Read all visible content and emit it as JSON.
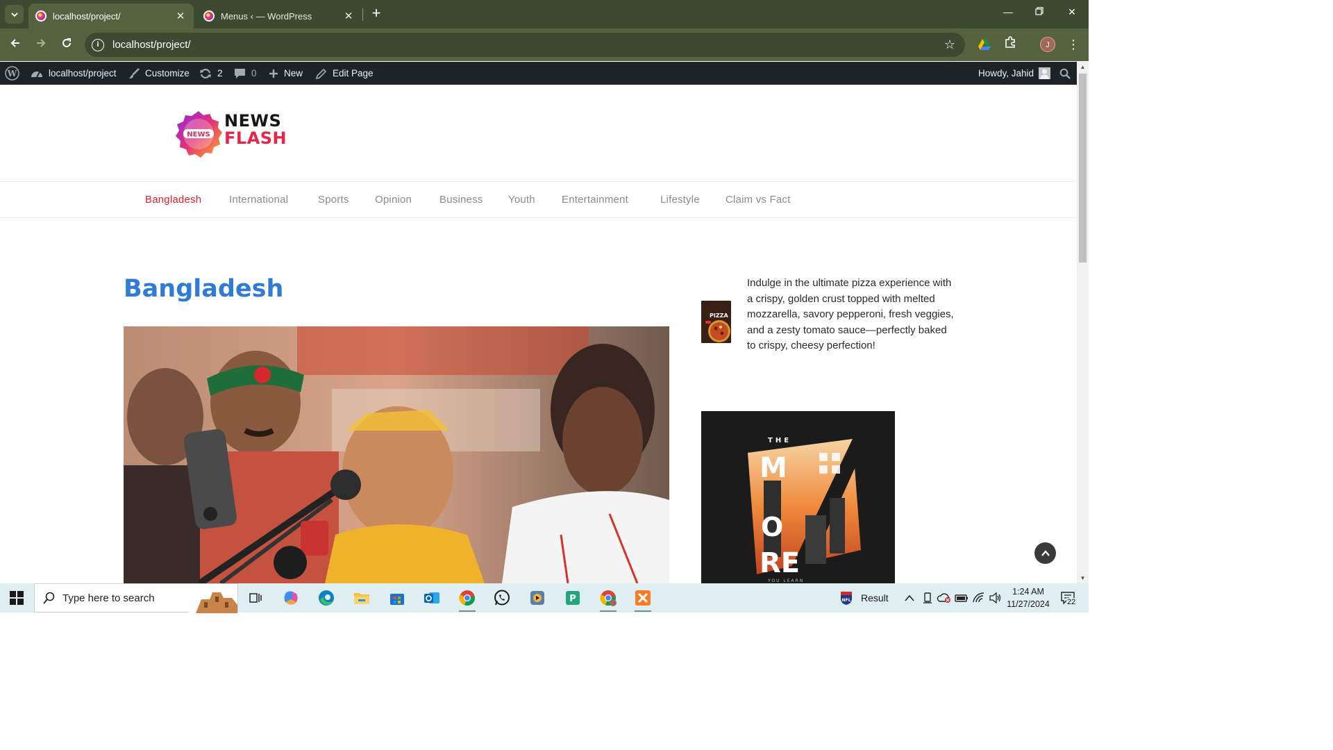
{
  "browser": {
    "tabs": [
      {
        "title": "localhost/project/",
        "active": true
      },
      {
        "title": "Menus ‹ — WordPress",
        "active": false
      }
    ],
    "address": "localhost/project/",
    "profile_initial": "J"
  },
  "admin_bar": {
    "site_name": "localhost/project",
    "customize": "Customize",
    "updates_count": "2",
    "comments_count": "0",
    "new_label": "New",
    "edit_page": "Edit Page",
    "howdy": "Howdy, Jahid"
  },
  "site": {
    "logo": {
      "line1": "NEWS",
      "line2": "FLASH",
      "badge": "NEWS"
    },
    "nav": [
      {
        "label": "Bangladesh",
        "active": true
      },
      {
        "label": "International",
        "active": false
      },
      {
        "label": "Sports",
        "active": false
      },
      {
        "label": "Opinion",
        "active": false
      },
      {
        "label": "Business",
        "active": false
      },
      {
        "label": "Youth",
        "active": false
      },
      {
        "label": "Entertainment",
        "active": false
      },
      {
        "label": "Lifestyle",
        "active": false
      },
      {
        "label": "Claim vs Fact",
        "active": false
      }
    ],
    "page_title": "Bangladesh",
    "sidebar": {
      "promo_text": "Indulge in the ultimate pizza experience with a crispy, golden crust topped with melted mozzarella, savory pepperoni, fresh veggies, and a zesty tomato sauce—perfectly baked to crispy, cheesy perfection!",
      "pizza_thumb_label": "PIZZA",
      "book": {
        "top": "THE",
        "big1": "M",
        "big2": "O",
        "big3": "RE",
        "bottom": "YOU LEARN"
      }
    },
    "colors": {
      "accent_red": "#e11f28",
      "title_blue": "#2f7bd6"
    }
  },
  "taskbar": {
    "search_placeholder": "Type here to search",
    "weather_label": "Result",
    "time": "1:24 AM",
    "date": "11/27/2024",
    "notifications": "22"
  }
}
